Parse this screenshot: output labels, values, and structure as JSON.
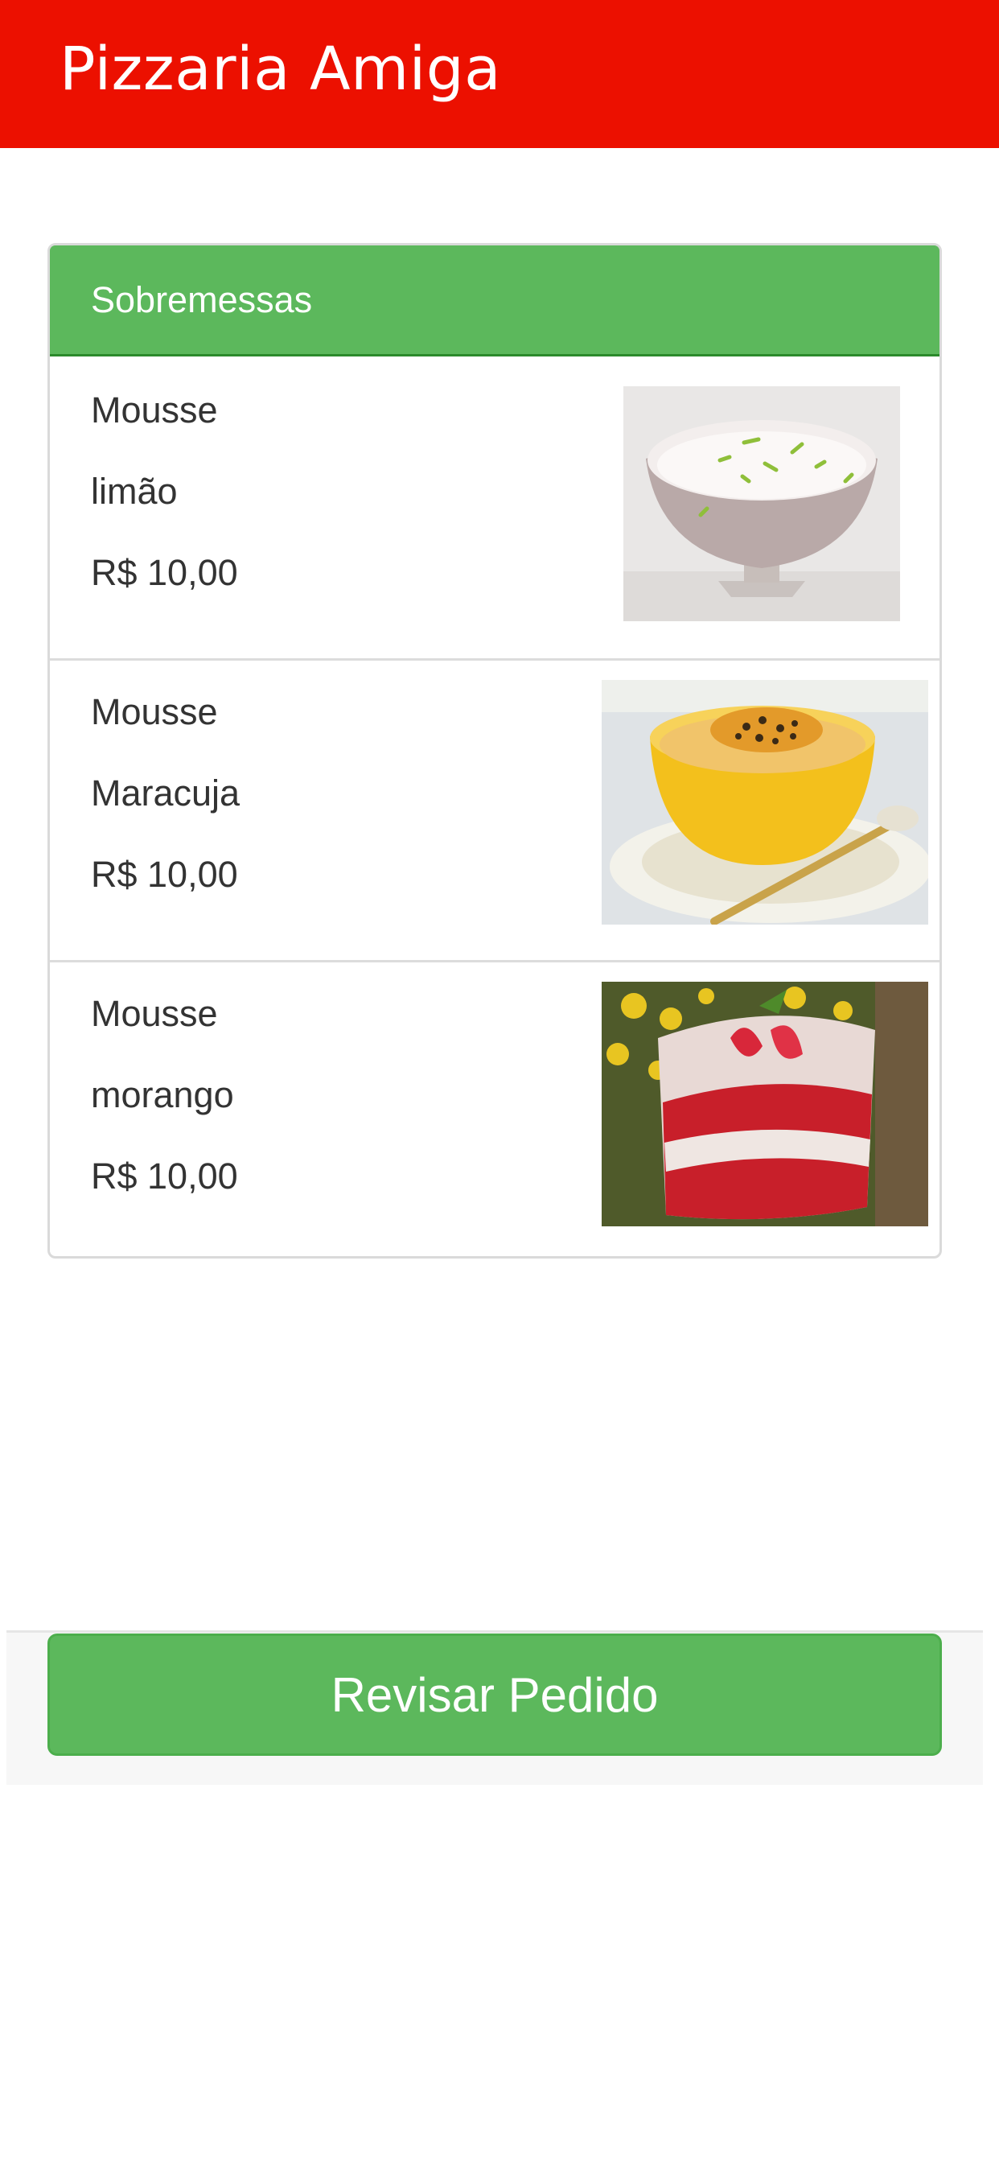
{
  "app_bar": {
    "title": "Pizzaria Amiga",
    "color": "#ec1000"
  },
  "panel": {
    "title": "Sobremessas",
    "items": [
      {
        "name_line1": "Mousse",
        "name_line2": "limão",
        "price": "R$ 10,00",
        "image": "lime-mousse-image"
      },
      {
        "name_line1": "Mousse",
        "name_line2": "Maracuja",
        "price": "R$ 10,00",
        "image": "passion-fruit-mousse-image"
      },
      {
        "name_line1": "Mousse",
        "name_line2": "morango",
        "price": "R$ 10,00",
        "image": "strawberry-mousse-image"
      }
    ]
  },
  "footer": {
    "review_button_label": "Revisar Pedido"
  },
  "colors": {
    "accent_green": "#5cb85c",
    "brand_red": "#ec1000"
  }
}
